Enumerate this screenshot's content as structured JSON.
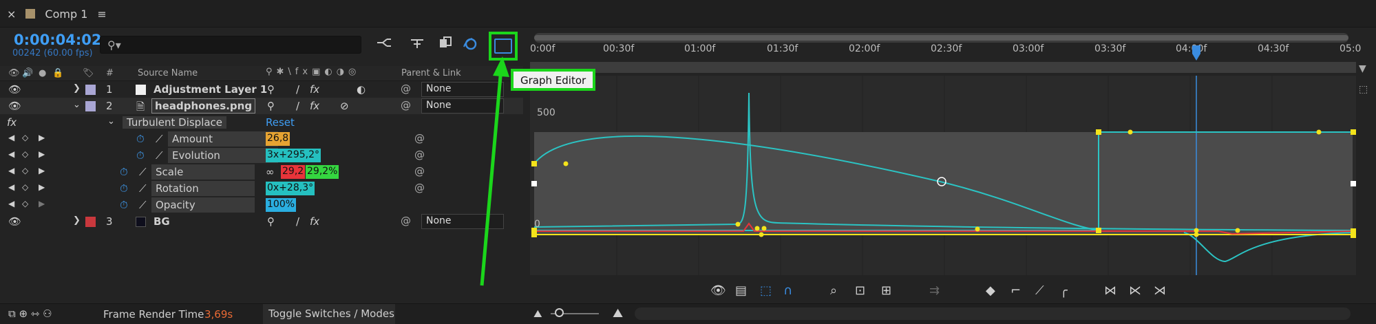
{
  "tab": {
    "close": "×",
    "title": "Comp 1",
    "menu": "≡"
  },
  "timecode": "0:00:04:02",
  "fps": "00242 (60.00 fps)",
  "search": {
    "icon": "⚲▾"
  },
  "toolbar_icons": [
    "comp-flowchart-icon",
    "draft-3d-icon",
    "frame-blending-icon",
    "motion-blur-icon",
    "graph-editor-icon"
  ],
  "columns": {
    "source_name": "Source Name",
    "num": "#",
    "parent_link": "Parent & Link"
  },
  "layers": [
    {
      "num": "1",
      "name": "Adjustment Layer 1",
      "parent": "None",
      "label_color": "#a9a6d4"
    },
    {
      "num": "2",
      "name": "headphones.png",
      "parent": "None",
      "label_color": "#a9a6d4"
    },
    {
      "num": "3",
      "name": "BG",
      "parent": "None",
      "label_color": "#c9383d"
    }
  ],
  "effect": {
    "fx": "fx",
    "name": "Turbulent Displace",
    "reset": "Reset"
  },
  "properties": [
    {
      "name": "Amount",
      "value": "26,8",
      "value_color": "#e6a332"
    },
    {
      "name": "Evolution",
      "value": "3x+295,2°",
      "value_color": "#25c0c0"
    },
    {
      "name": "Scale",
      "value_x": "29,2",
      "value_y": "29,2%",
      "value_x_color": "#e8343a",
      "value_y_color": "#35d640"
    },
    {
      "name": "Rotation",
      "value": "0x+28,3°",
      "value_color": "#25c0c0"
    },
    {
      "name": "Opacity",
      "value": "100%",
      "value_color": "#2aaee0"
    }
  ],
  "ruler_ticks": [
    "0:00f",
    "00:30f",
    "01:00f",
    "01:30f",
    "02:00f",
    "02:30f",
    "03:00f",
    "03:30f",
    "04:00f",
    "04:30f",
    "05:0"
  ],
  "graph": {
    "y_label_500": "500",
    "y_label_0": "0"
  },
  "tooltip": "Graph Editor",
  "status": {
    "frame_render_label": "Frame Render Time",
    "frame_render_value": "3,69s",
    "toggle": "Toggle Switches / Modes"
  },
  "colors": {
    "accent_blue": "#3f9ef5",
    "highlight_green": "#1bd61b",
    "curve_cyan": "#2bc4c4",
    "keyframe_yellow": "#f4e31b"
  }
}
